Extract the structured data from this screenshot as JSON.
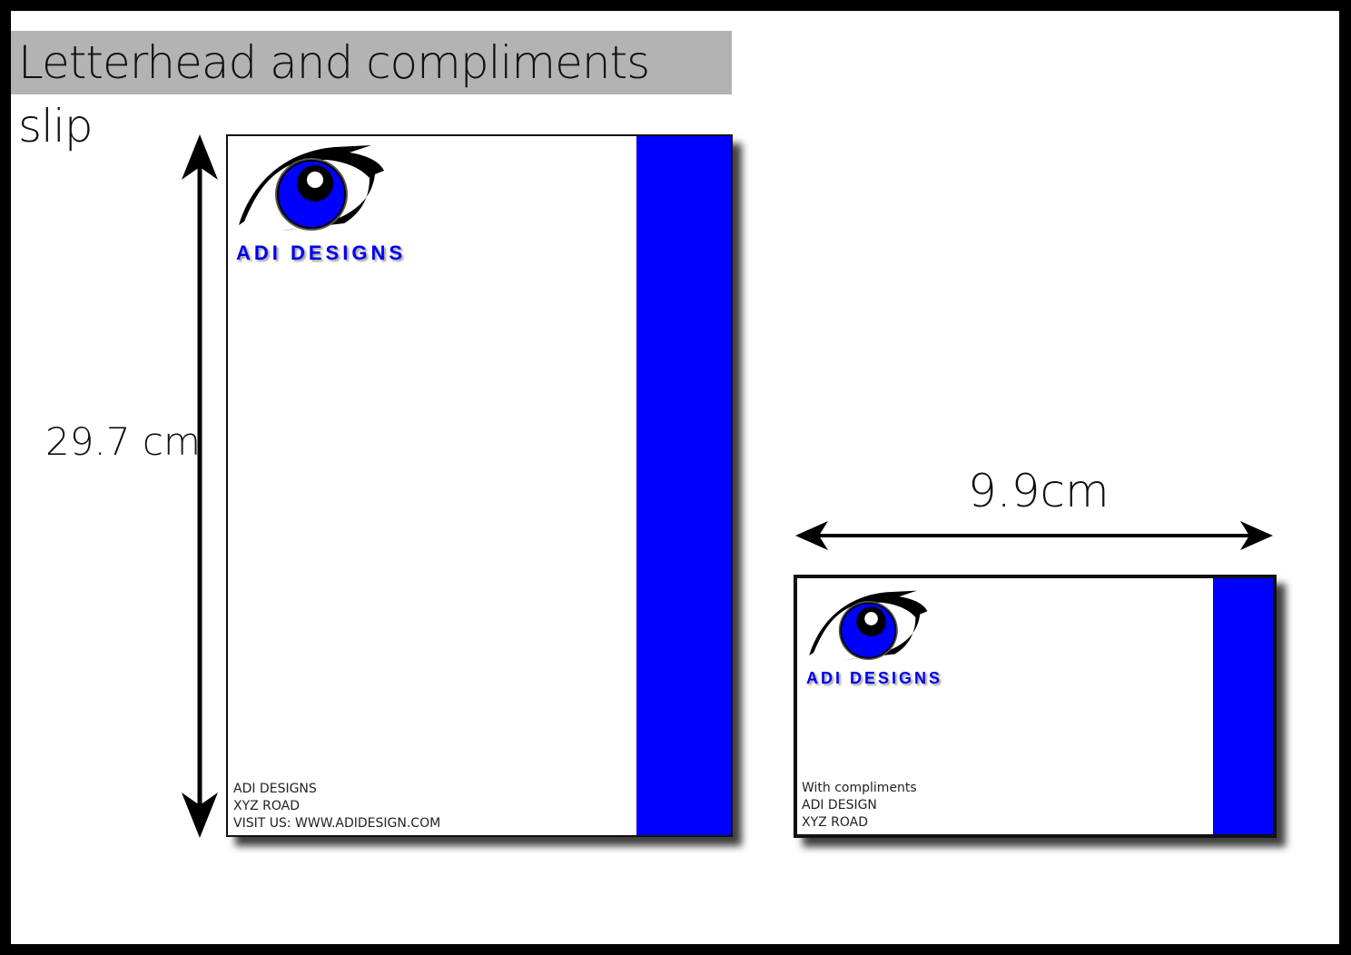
{
  "title": "Letterhead and compliments slip",
  "dimensions": {
    "height_label": "29.7 cm",
    "width_label": "9.9cm"
  },
  "letterhead": {
    "brand": "ADI DESIGNS",
    "footer": [
      "ADI DESIGNS",
      "XYZ ROAD",
      "VISIT US: WWW.ADIDESIGN.COM"
    ]
  },
  "compliments_slip": {
    "brand": "ADI DESIGNS",
    "footer": [
      "With compliments",
      "ADI DESIGN",
      "XYZ ROAD"
    ]
  },
  "colors": {
    "accent": "#0000ff",
    "title_bg": "#b3b3b3"
  }
}
